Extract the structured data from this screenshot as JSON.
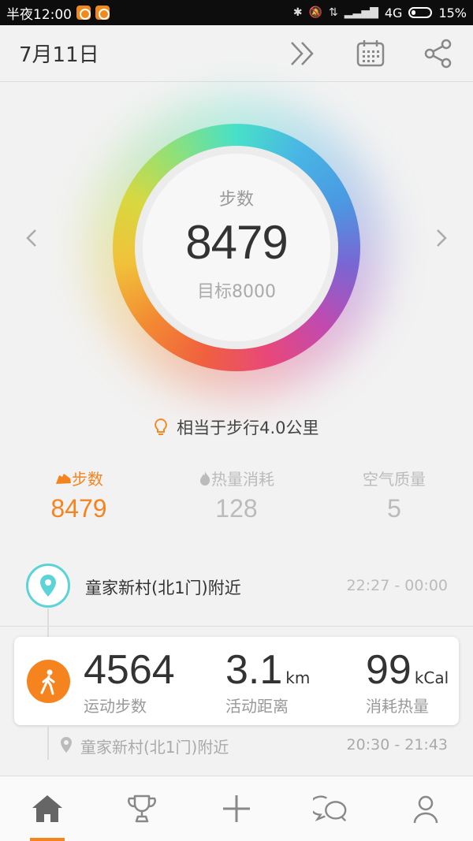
{
  "status_bar": {
    "time": "半夜12:00",
    "network": "4G",
    "battery": "15%"
  },
  "header": {
    "date": "7月11日",
    "icons": [
      "double-chevron-right-icon",
      "calendar-icon",
      "share-icon"
    ]
  },
  "ring": {
    "label": "步数",
    "value": "8479",
    "goal": "目标8000",
    "progress_fraction": 1.0
  },
  "tip": {
    "text": "相当于步行4.0公里"
  },
  "stats": [
    {
      "label": "步数",
      "value": "8479",
      "icon": "shoe-icon",
      "active": true
    },
    {
      "label": "热量消耗",
      "value": "128",
      "icon": "flame-icon",
      "active": false
    },
    {
      "label": "空气质量",
      "value": "5",
      "icon": "",
      "active": false
    }
  ],
  "timeline": {
    "location_1": {
      "name": "童家新村(北1门)附近",
      "time": "22:27 - 00:00"
    },
    "activity": {
      "steps": {
        "value": "4564",
        "label": "运动步数"
      },
      "distance": {
        "value": "3.1",
        "unit": "km",
        "label": "活动距离"
      },
      "calories": {
        "value": "99",
        "unit": "kCal",
        "label": "消耗热量"
      }
    },
    "location_2": {
      "name": "童家新村(北1门)附近",
      "time": "20:30 - 21:43"
    }
  },
  "nav": {
    "items": [
      "home-icon",
      "trophy-icon",
      "plus-icon",
      "chat-icon",
      "profile-icon"
    ],
    "active_index": 0
  },
  "colors": {
    "accent": "#f5841f",
    "pin": "#5cd3d6"
  }
}
